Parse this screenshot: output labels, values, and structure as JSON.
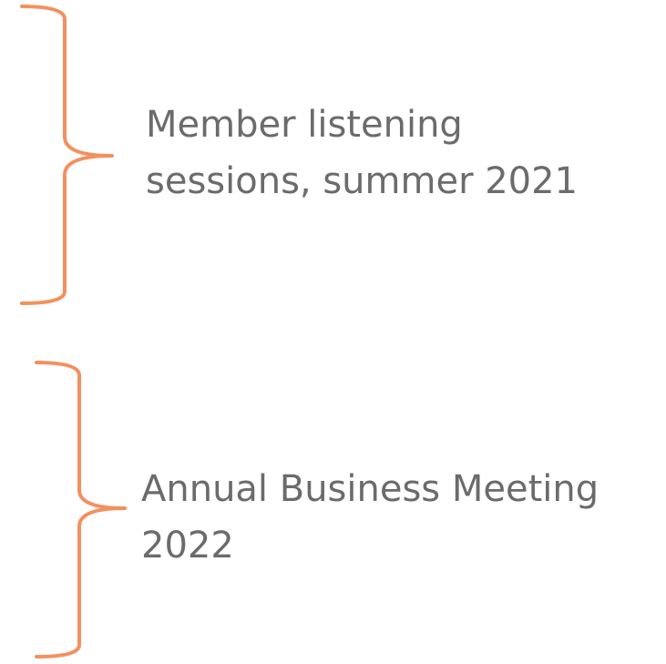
{
  "colors": {
    "brace": "#f4905e",
    "text": "#6b6b6b"
  },
  "groups": [
    {
      "line1": "Member listening",
      "line2": "sessions, summer 2021"
    },
    {
      "line1": "Annual Business Meeting",
      "line2": "2022"
    }
  ]
}
